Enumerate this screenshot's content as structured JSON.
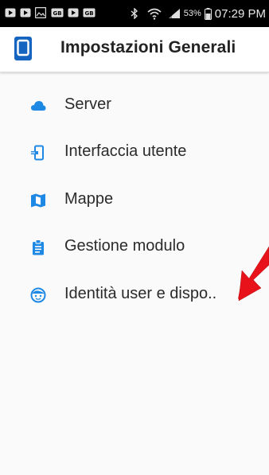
{
  "status_bar": {
    "battery_percent": "53%",
    "time": "07:29 PM"
  },
  "app_bar": {
    "title": "Impostazioni Generali",
    "logo_icon": "phone-device-icon"
  },
  "menu": {
    "items": [
      {
        "label": "Server",
        "icon": "cloud-icon"
      },
      {
        "label": "Interfaccia utente",
        "icon": "device-settings-icon"
      },
      {
        "label": "Mappe",
        "icon": "map-icon"
      },
      {
        "label": "Gestione modulo",
        "icon": "clipboard-icon"
      },
      {
        "label": "Identità user e dispo..",
        "icon": "face-icon"
      }
    ]
  },
  "colors": {
    "accent": "#1e88e5",
    "status_bar": "#000000",
    "app_logo": "#1565c0",
    "annotation_arrow": "#e8131a"
  }
}
